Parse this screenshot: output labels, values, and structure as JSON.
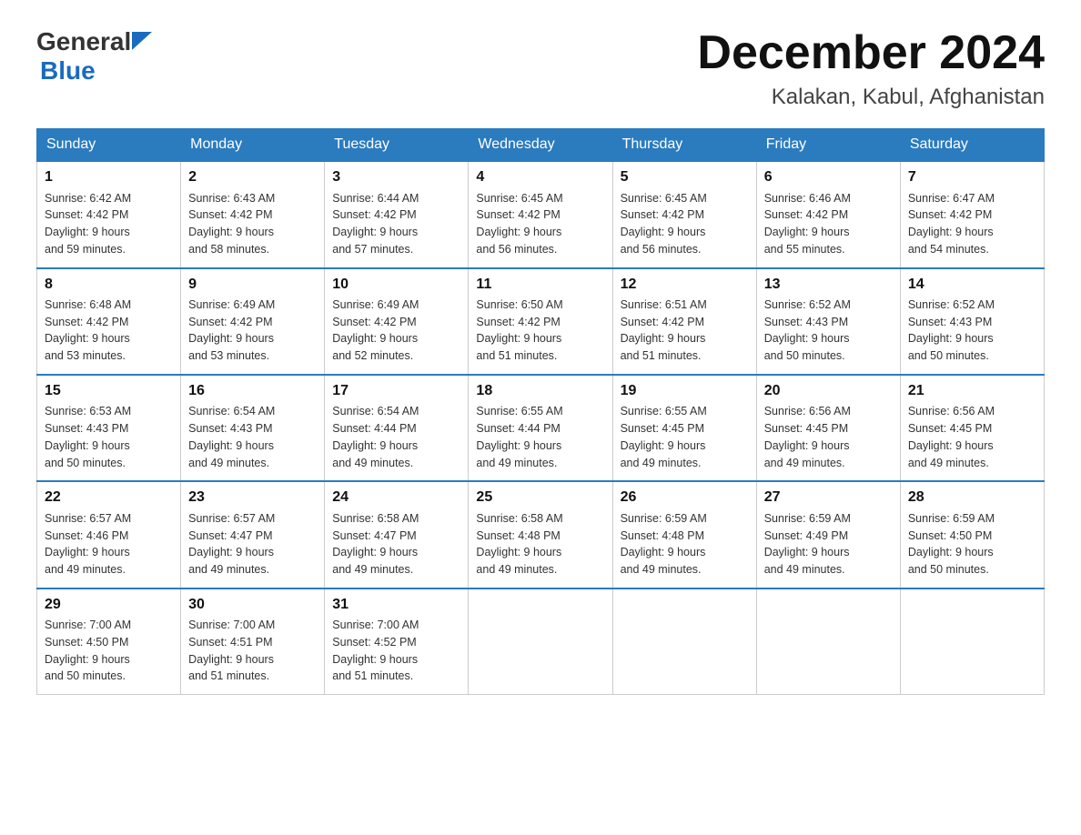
{
  "header": {
    "logo_general": "General",
    "logo_blue": "Blue",
    "month_title": "December 2024",
    "location": "Kalakan, Kabul, Afghanistan"
  },
  "days_of_week": [
    "Sunday",
    "Monday",
    "Tuesday",
    "Wednesday",
    "Thursday",
    "Friday",
    "Saturday"
  ],
  "weeks": [
    [
      {
        "day": "1",
        "sunrise": "6:42 AM",
        "sunset": "4:42 PM",
        "daylight": "9 hours and 59 minutes."
      },
      {
        "day": "2",
        "sunrise": "6:43 AM",
        "sunset": "4:42 PM",
        "daylight": "9 hours and 58 minutes."
      },
      {
        "day": "3",
        "sunrise": "6:44 AM",
        "sunset": "4:42 PM",
        "daylight": "9 hours and 57 minutes."
      },
      {
        "day": "4",
        "sunrise": "6:45 AM",
        "sunset": "4:42 PM",
        "daylight": "9 hours and 56 minutes."
      },
      {
        "day": "5",
        "sunrise": "6:45 AM",
        "sunset": "4:42 PM",
        "daylight": "9 hours and 56 minutes."
      },
      {
        "day": "6",
        "sunrise": "6:46 AM",
        "sunset": "4:42 PM",
        "daylight": "9 hours and 55 minutes."
      },
      {
        "day": "7",
        "sunrise": "6:47 AM",
        "sunset": "4:42 PM",
        "daylight": "9 hours and 54 minutes."
      }
    ],
    [
      {
        "day": "8",
        "sunrise": "6:48 AM",
        "sunset": "4:42 PM",
        "daylight": "9 hours and 53 minutes."
      },
      {
        "day": "9",
        "sunrise": "6:49 AM",
        "sunset": "4:42 PM",
        "daylight": "9 hours and 53 minutes."
      },
      {
        "day": "10",
        "sunrise": "6:49 AM",
        "sunset": "4:42 PM",
        "daylight": "9 hours and 52 minutes."
      },
      {
        "day": "11",
        "sunrise": "6:50 AM",
        "sunset": "4:42 PM",
        "daylight": "9 hours and 51 minutes."
      },
      {
        "day": "12",
        "sunrise": "6:51 AM",
        "sunset": "4:42 PM",
        "daylight": "9 hours and 51 minutes."
      },
      {
        "day": "13",
        "sunrise": "6:52 AM",
        "sunset": "4:43 PM",
        "daylight": "9 hours and 50 minutes."
      },
      {
        "day": "14",
        "sunrise": "6:52 AM",
        "sunset": "4:43 PM",
        "daylight": "9 hours and 50 minutes."
      }
    ],
    [
      {
        "day": "15",
        "sunrise": "6:53 AM",
        "sunset": "4:43 PM",
        "daylight": "9 hours and 50 minutes."
      },
      {
        "day": "16",
        "sunrise": "6:54 AM",
        "sunset": "4:43 PM",
        "daylight": "9 hours and 49 minutes."
      },
      {
        "day": "17",
        "sunrise": "6:54 AM",
        "sunset": "4:44 PM",
        "daylight": "9 hours and 49 minutes."
      },
      {
        "day": "18",
        "sunrise": "6:55 AM",
        "sunset": "4:44 PM",
        "daylight": "9 hours and 49 minutes."
      },
      {
        "day": "19",
        "sunrise": "6:55 AM",
        "sunset": "4:45 PM",
        "daylight": "9 hours and 49 minutes."
      },
      {
        "day": "20",
        "sunrise": "6:56 AM",
        "sunset": "4:45 PM",
        "daylight": "9 hours and 49 minutes."
      },
      {
        "day": "21",
        "sunrise": "6:56 AM",
        "sunset": "4:45 PM",
        "daylight": "9 hours and 49 minutes."
      }
    ],
    [
      {
        "day": "22",
        "sunrise": "6:57 AM",
        "sunset": "4:46 PM",
        "daylight": "9 hours and 49 minutes."
      },
      {
        "day": "23",
        "sunrise": "6:57 AM",
        "sunset": "4:47 PM",
        "daylight": "9 hours and 49 minutes."
      },
      {
        "day": "24",
        "sunrise": "6:58 AM",
        "sunset": "4:47 PM",
        "daylight": "9 hours and 49 minutes."
      },
      {
        "day": "25",
        "sunrise": "6:58 AM",
        "sunset": "4:48 PM",
        "daylight": "9 hours and 49 minutes."
      },
      {
        "day": "26",
        "sunrise": "6:59 AM",
        "sunset": "4:48 PM",
        "daylight": "9 hours and 49 minutes."
      },
      {
        "day": "27",
        "sunrise": "6:59 AM",
        "sunset": "4:49 PM",
        "daylight": "9 hours and 49 minutes."
      },
      {
        "day": "28",
        "sunrise": "6:59 AM",
        "sunset": "4:50 PM",
        "daylight": "9 hours and 50 minutes."
      }
    ],
    [
      {
        "day": "29",
        "sunrise": "7:00 AM",
        "sunset": "4:50 PM",
        "daylight": "9 hours and 50 minutes."
      },
      {
        "day": "30",
        "sunrise": "7:00 AM",
        "sunset": "4:51 PM",
        "daylight": "9 hours and 51 minutes."
      },
      {
        "day": "31",
        "sunrise": "7:00 AM",
        "sunset": "4:52 PM",
        "daylight": "9 hours and 51 minutes."
      },
      null,
      null,
      null,
      null
    ]
  ],
  "labels": {
    "sunrise": "Sunrise:",
    "sunset": "Sunset:",
    "daylight": "Daylight:"
  }
}
